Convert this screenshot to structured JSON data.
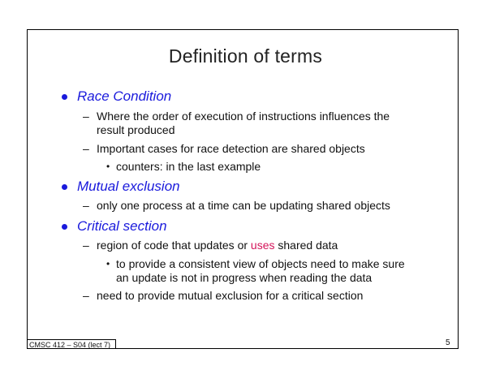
{
  "slide": {
    "title": "Definition of terms",
    "sections": [
      {
        "heading": "Race Condition",
        "items": [
          {
            "line1": "Where the order of execution of instructions influences the",
            "line2": "result produced"
          },
          {
            "line1": "Important cases for race detection are shared objects",
            "sub": "counters: in the last example"
          }
        ]
      },
      {
        "heading": "Mutual exclusion",
        "items": [
          {
            "line1": "only one process at a time can be updating shared objects"
          }
        ]
      },
      {
        "heading": "Critical section",
        "items": [
          {
            "line1_before": "region of code that updates or ",
            "line1_highlight": "uses",
            "line1_after": " shared data",
            "sub_line1": "to provide a consistent view of objects need to make sure",
            "sub_line2": "an update is not in progress when reading the data"
          },
          {
            "line1": "need to provide mutual exclusion for a critical section"
          }
        ]
      }
    ],
    "footer_left": "CMSC 412 – S04  (lect 7)",
    "page_number": "5"
  },
  "colors": {
    "heading": "#1a1adc",
    "highlight": "#d4145a",
    "text": "#111111"
  },
  "icons": {
    "bullet": "filled-circle",
    "sub_bullet": "dash",
    "sub_sub_bullet": "small-dot"
  }
}
